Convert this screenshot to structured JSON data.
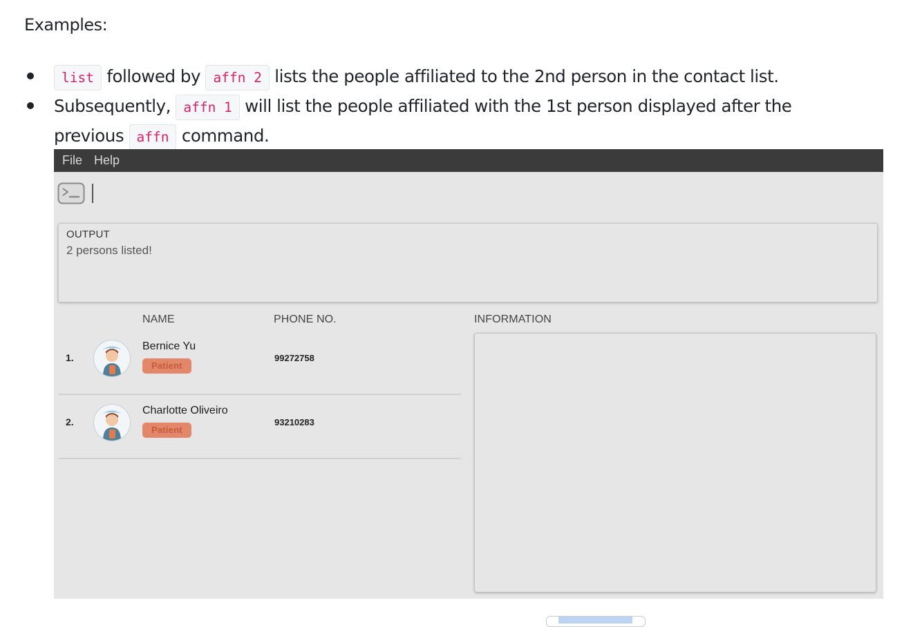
{
  "doc": {
    "heading": "Examples:",
    "bullet1": {
      "code1": "list",
      "text1": "followed by",
      "code2": "affn 2",
      "text2": "lists the people affiliated to the 2nd person in the contact list."
    },
    "bullet2": {
      "text1": "Subsequently,",
      "code1": "affn 1",
      "text2": "will list the people affiliated with the 1st person displayed after the",
      "text3": "previous",
      "code2": "affn",
      "text4": "command."
    }
  },
  "app": {
    "menu": [
      "File",
      "Help"
    ],
    "command_input": {
      "value": "",
      "icon": "terminal-icon"
    },
    "output": {
      "title": "OUTPUT",
      "text": "2 persons listed!"
    },
    "columns": {
      "name": "NAME",
      "phone": "PHONE NO.",
      "info": "INFORMATION"
    },
    "persons": [
      {
        "index": "1.",
        "name": "Bernice Yu",
        "tag": "Patient",
        "phone": "99272758"
      },
      {
        "index": "2.",
        "name": "Charlotte Oliveiro",
        "tag": "Patient",
        "phone": "93210283"
      }
    ]
  },
  "colors": {
    "menubar": "#3b3b3b",
    "app_background": "#e6e6e6",
    "tag_background": "#e2876a",
    "tag_text": "#c55b3b",
    "inline_code": "#d6216b"
  }
}
